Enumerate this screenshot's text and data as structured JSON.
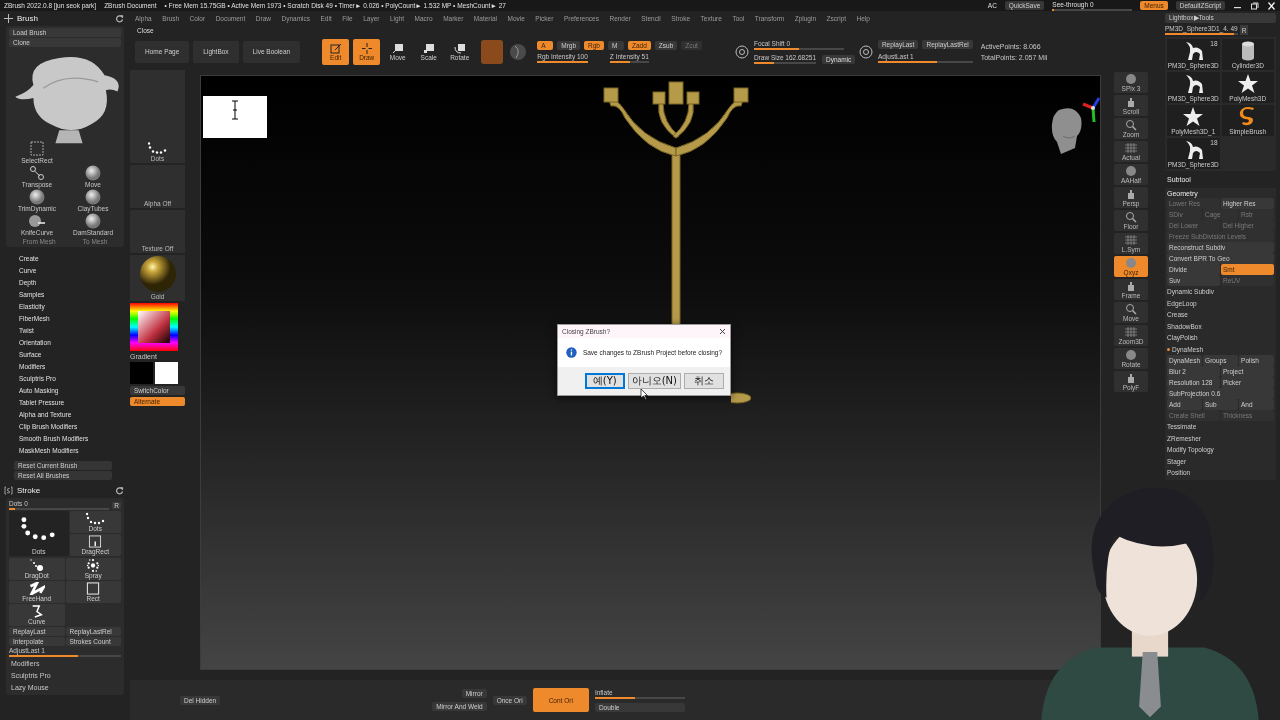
{
  "title_bar": {
    "app": "ZBrush 2022.0.8 [jun seok park]",
    "document": "ZBrush Document",
    "stats": "• Free Mem 15.75GB • Active Mem 1973 • Scratch Disk 49 • Timer► 0.026 • PolyCount► 1.532 MP • MeshCount► 27",
    "ac": "AC",
    "quicksave": "QuickSave",
    "see_through": {
      "label": "See-through  0",
      "level": 0.02
    },
    "menus": {
      "label": "Menus",
      "on": true
    },
    "script": "DefaultZScript"
  },
  "menu_bar": [
    "Alpha",
    "Brush",
    "Color",
    "Document",
    "Draw",
    "Dynamics",
    "Edit",
    "File",
    "Layer",
    "Light",
    "Macro",
    "Marker",
    "Material",
    "Movie",
    "Picker",
    "Preferences",
    "Render",
    "Stencil",
    "Stroke",
    "Texture",
    "Tool",
    "Transform",
    "Zplugin",
    "Zscript",
    "Help"
  ],
  "close_item": "Close",
  "top_buttons": [
    "Home Page",
    "LightBox",
    "Live Boolean"
  ],
  "toolbar": {
    "modes": [
      {
        "label": "Edit",
        "on": true
      },
      {
        "label": "Draw",
        "on": true
      },
      {
        "label": "Move",
        "on": false
      },
      {
        "label": "Scale",
        "on": false
      },
      {
        "label": "Rotate",
        "on": false
      }
    ],
    "channels_row1": [
      {
        "label": "A",
        "on": true,
        "disabled": false
      },
      {
        "label": "Mrgb",
        "on": false,
        "disabled": false
      },
      {
        "label": "Rgb",
        "on": true,
        "disabled": false
      },
      {
        "label": "M",
        "on": false,
        "disabled": false
      },
      {
        "label": "Zadd",
        "on": true,
        "disabled": false
      },
      {
        "label": "Zsub",
        "on": false,
        "disabled": false
      },
      {
        "label": "Zcut",
        "on": false,
        "disabled": true
      }
    ],
    "rgb_intensity": {
      "label": "Rgb Intensity 100",
      "level": 1
    },
    "z_intensity": {
      "label": "Z Intensity 51",
      "level": 0.51
    },
    "focal_shift": {
      "label": "Focal Shift 0",
      "level": 0.5
    },
    "draw_size": {
      "label": "Draw Size 162.68251",
      "level": 0.33
    },
    "dynamic": "Dynamic",
    "replay": [
      "ReplayLast",
      "ReplayLastRel"
    ],
    "adjust_last": {
      "label": "AdjustLast 1",
      "level": 0.62
    },
    "active_points": "ActivePoints: 8.066",
    "total_points": "TotalPoints: 2.057 Mil"
  },
  "brush_palette": {
    "title": "Brush",
    "top_buttons": [
      "Load Brush",
      "Clone"
    ],
    "brushes": [
      {
        "label": "SelectRect",
        "kind": "rect"
      },
      {
        "label": "Transpose",
        "kind": "transpose"
      },
      {
        "label": "Move",
        "kind": "sphere"
      },
      {
        "label": "TrimDynamic",
        "kind": "sphere"
      },
      {
        "label": "ClayTubes",
        "kind": "sphere"
      },
      {
        "label": "KnifeCurve",
        "kind": "knife"
      },
      {
        "label": "DamStandard",
        "kind": "sphere"
      }
    ],
    "mesh_buttons": [
      {
        "label": "From Mesh",
        "disabled": true
      },
      {
        "label": "To Mesh",
        "disabled": true
      }
    ],
    "subpalettes": [
      "Create",
      "Curve",
      "Depth",
      "Samples",
      "Elasticity",
      "FiberMesh",
      "Twist",
      "Orientation",
      "Surface",
      "Modifiers",
      "Sculptris Pro",
      "Auto Masking",
      "Tablet Pressure",
      "Alpha and Texture",
      "Clip Brush Modifiers",
      "Smooth Brush Modifiers",
      "MaskMesh Modifiers"
    ],
    "reset": [
      "Reset Current Brush",
      "Reset All Brushes"
    ]
  },
  "side_column": {
    "stroke_thumb": "Dots",
    "alpha": "Alpha Off",
    "texture": "Texture Off",
    "material": "Gold",
    "gradient": "Gradient",
    "switch_color": "SwitchColor",
    "alternate": {
      "label": "Alternate",
      "on": true
    }
  },
  "stroke_palette": {
    "title": "Stroke",
    "dots_slider": {
      "label": "Dots  0",
      "level": 0.06
    },
    "r": "R",
    "current_stroke": {
      "label": "Dots",
      "kind": "dots-large"
    },
    "strokes": [
      {
        "label": "Dots",
        "kind": "dots"
      },
      {
        "label": "DragRect",
        "kind": "dragrect"
      },
      {
        "label": "DragDot",
        "kind": "dragdot"
      },
      {
        "label": "Spray",
        "kind": "spray"
      },
      {
        "label": "FreeHand",
        "kind": "freehand"
      },
      {
        "label": "Rect",
        "kind": "rect"
      },
      {
        "label": "Curve",
        "kind": "curve"
      }
    ],
    "buttons": [
      "ReplayLast",
      "ReplayLastRel",
      "Interpolate",
      "Strokes Count"
    ],
    "adjust_last": {
      "label": "AdjustLast 1",
      "level": 0.62
    },
    "subpalettes": [
      "Modifiers",
      "Sculptris Pro",
      "Lazy Mouse"
    ]
  },
  "shelf": [
    {
      "label": "SPix 3",
      "on": false
    },
    {
      "label": "Scroll",
      "on": false
    },
    {
      "label": "Zoom",
      "on": false
    },
    {
      "label": "Actual",
      "on": false
    },
    {
      "label": "AAHalf",
      "on": false
    },
    {
      "label": "Persp",
      "on": false
    },
    {
      "label": "Floor",
      "on": false
    },
    {
      "label": "L.Sym",
      "on": false
    },
    {
      "label": "Qxyz",
      "on": true
    },
    {
      "label": "Frame",
      "on": false
    },
    {
      "label": "Move",
      "on": false
    },
    {
      "label": "Zoom3D",
      "on": false
    },
    {
      "label": "Rotate",
      "on": false
    },
    {
      "label": "PolyF",
      "on": false
    }
  ],
  "tool_panel": {
    "lightbox_tools": "Lightbox▶Tools",
    "tool_slider": {
      "label": "PM3D_Sphere3D1_4. 49",
      "level": 0.95
    },
    "r": "R",
    "tools": [
      {
        "label": "PM3D_Sphere3D",
        "count": "18",
        "kind": "figure"
      },
      {
        "label": "Cylinder3D",
        "kind": "cylinder"
      },
      {
        "label": "PM3D_Sphere3D",
        "kind": "figure"
      },
      {
        "label": "PolyMesh3D",
        "kind": "star"
      },
      {
        "label": "PolyMesh3D_1",
        "kind": "star"
      },
      {
        "label": "SimpleBrush",
        "kind": "swirl"
      },
      {
        "label": "PM3D_Sphere3D",
        "count": "18",
        "kind": "figure"
      }
    ],
    "subtool": "Subtool",
    "geometry": "Geometry",
    "items": [
      {
        "kind": "row",
        "buttons": [
          {
            "label": "Lower Res",
            "disabled": true,
            "on": false
          },
          {
            "label": "Higher Res",
            "disabled": false,
            "on": false
          }
        ]
      },
      {
        "kind": "row",
        "buttons": [
          {
            "label": "SDiv",
            "disabled": true,
            "on": false
          },
          {
            "label": "Cage",
            "disabled": true,
            "on": false
          },
          {
            "label": "Rstr",
            "disabled": true,
            "on": false
          }
        ]
      },
      {
        "kind": "row",
        "buttons": [
          {
            "label": "Del Lower",
            "disabled": true,
            "on": false
          },
          {
            "label": "Del Higher",
            "disabled": true,
            "on": false
          }
        ]
      },
      {
        "kind": "row",
        "buttons": [
          {
            "label": "Freeze SubDivision Levels",
            "disabled": true,
            "on": false
          }
        ]
      },
      {
        "kind": "row",
        "buttons": [
          {
            "label": "Reconstruct Subdiv",
            "disabled": false,
            "on": false
          }
        ]
      },
      {
        "kind": "row",
        "buttons": [
          {
            "label": "Convert BPR To Geo",
            "disabled": false,
            "on": false
          }
        ]
      },
      {
        "kind": "row",
        "buttons": [
          {
            "label": "Divide",
            "disabled": false,
            "on": false
          },
          {
            "label": "Smt",
            "disabled": false,
            "on": true
          }
        ]
      },
      {
        "kind": "row",
        "buttons": [
          {
            "label": "Suv",
            "disabled": false,
            "on": false
          },
          {
            "label": "ReUV",
            "disabled": true,
            "on": false
          }
        ]
      },
      {
        "kind": "header",
        "label": "Dynamic Subdiv",
        "active": false
      },
      {
        "kind": "header",
        "label": "EdgeLoop",
        "active": false
      },
      {
        "kind": "header",
        "label": "Crease",
        "active": false
      },
      {
        "kind": "header",
        "label": "ShadowBox",
        "active": false
      },
      {
        "kind": "header",
        "label": "ClayPolish",
        "active": false
      },
      {
        "kind": "header",
        "label": "DynaMesh",
        "active": true
      },
      {
        "kind": "row",
        "buttons": [
          {
            "label": "DynaMesh",
            "disabled": false,
            "on": false
          },
          {
            "label": "Groups",
            "disabled": false,
            "on": false
          },
          {
            "label": "Polish",
            "disabled": false,
            "on": false
          }
        ]
      },
      {
        "kind": "row",
        "buttons": [
          {
            "label": "Blur 2",
            "disabled": false,
            "on": false
          },
          {
            "label": "Project",
            "disabled": false,
            "on": false
          }
        ]
      },
      {
        "kind": "row",
        "buttons": [
          {
            "label": "Resolution 128",
            "disabled": false,
            "on": false
          },
          {
            "label": "Picker",
            "disabled": false,
            "on": false
          }
        ]
      },
      {
        "kind": "row",
        "buttons": [
          {
            "label": "SubProjection 0.6",
            "disabled": false,
            "on": false
          }
        ]
      },
      {
        "kind": "row",
        "buttons": [
          {
            "label": "Add",
            "disabled": false,
            "on": false
          },
          {
            "label": "Sub",
            "disabled": false,
            "on": false
          },
          {
            "label": "And",
            "disabled": false,
            "on": false
          }
        ]
      },
      {
        "kind": "row",
        "buttons": [
          {
            "label": "Create Shell",
            "disabled": true,
            "on": false
          },
          {
            "label": "Thickness",
            "disabled": true,
            "on": false
          }
        ]
      },
      {
        "kind": "header",
        "label": "Tessimate",
        "active": false
      },
      {
        "kind": "header",
        "label": "ZRemesher",
        "active": false
      },
      {
        "kind": "header",
        "label": "Modify Topology",
        "active": false
      },
      {
        "kind": "header",
        "label": "Stager",
        "active": false
      },
      {
        "kind": "header",
        "label": "Position",
        "active": false
      }
    ]
  },
  "bottom_bar": {
    "del_hidden": "Del Hidden",
    "mirror": "Mirror",
    "mirror_weld": "Mirror And Weld",
    "once_ori": "Once Ori",
    "cont_ori": {
      "label": "Cont Ori",
      "on": true
    },
    "inflate": {
      "label": "Inflate",
      "level": 0.45
    },
    "double": "Double"
  },
  "dialog": {
    "title": "Closing ZBrush?",
    "message": "Save changes to ZBrush Project before closing?",
    "buttons": [
      {
        "label": "예(Y)",
        "selected": true
      },
      {
        "label": "아니오(N)",
        "selected": false
      },
      {
        "label": "취소",
        "selected": false
      }
    ]
  }
}
